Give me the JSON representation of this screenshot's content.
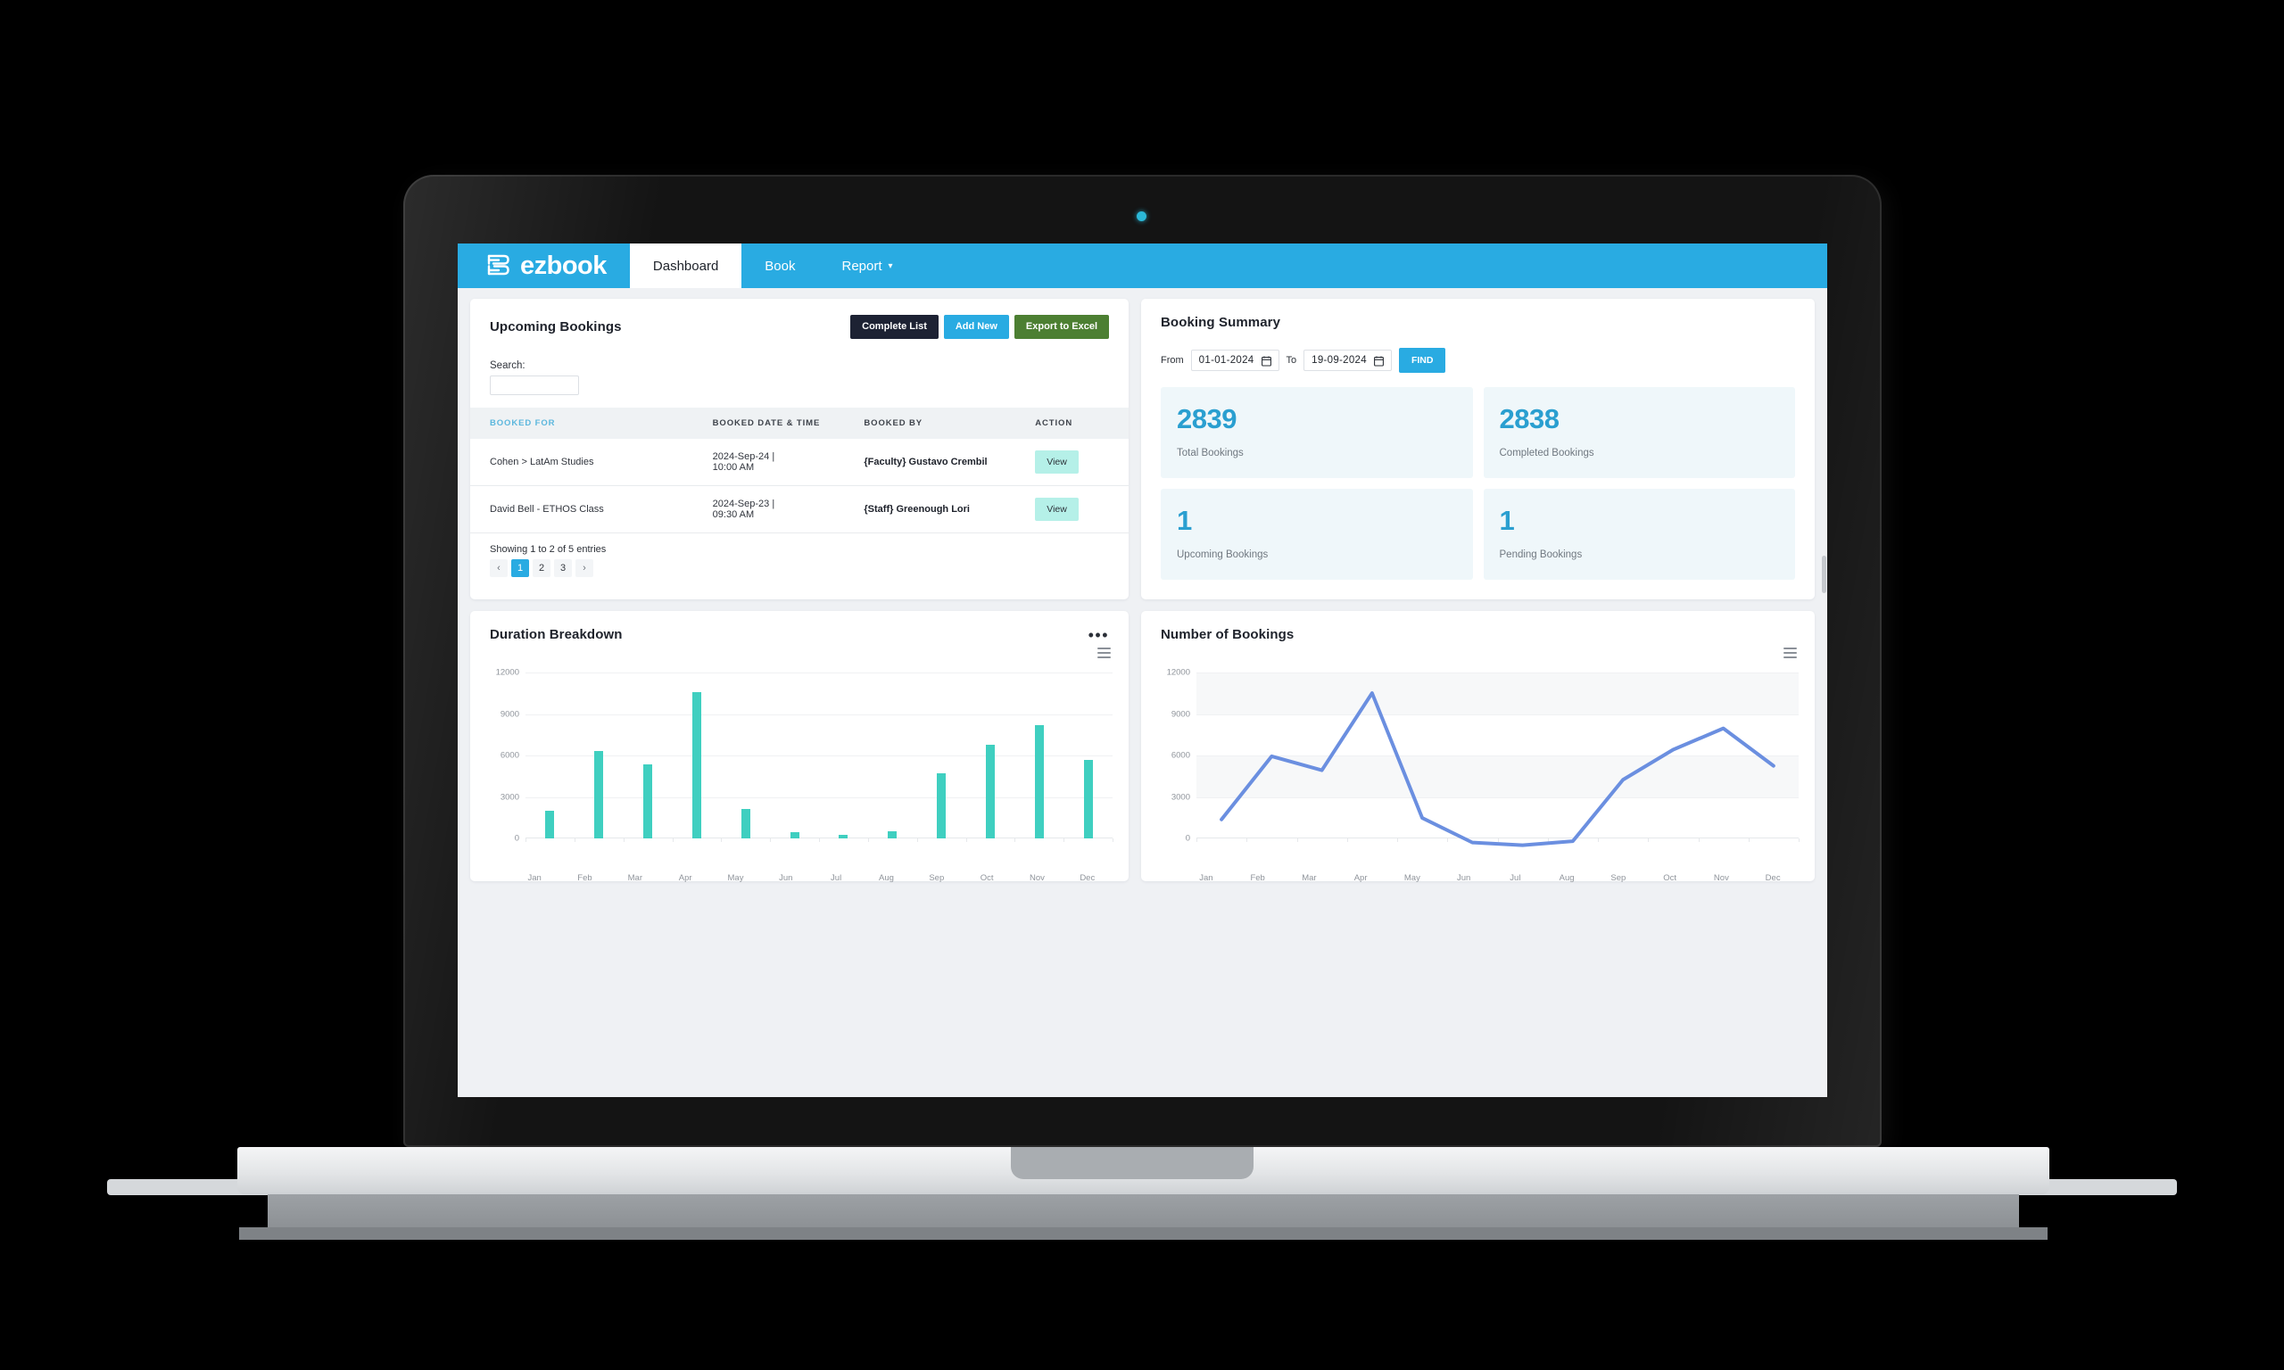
{
  "brand": {
    "name": "ezbook",
    "logo_icon": "ezbook-logo-icon"
  },
  "nav": {
    "items": [
      {
        "label": "Dashboard",
        "active": true
      },
      {
        "label": "Book",
        "active": false
      },
      {
        "label": "Report",
        "active": false,
        "caret": "⌄"
      }
    ]
  },
  "upcoming": {
    "title": "Upcoming Bookings",
    "buttons": {
      "complete_list": "Complete List",
      "add_new": "Add New",
      "export": "Export to Excel"
    },
    "search_label": "Search:",
    "search_value": "",
    "search_placeholder": "",
    "columns": [
      "BOOKED FOR",
      "BOOKED DATE & TIME",
      "BOOKED BY",
      "ACTION"
    ],
    "rows": [
      {
        "booked_for": "Cohen > LatAm Studies",
        "date": "2024-Sep-24 |",
        "time": "10:00 AM",
        "booked_by": "{Faculty} Gustavo Crembil",
        "action": "View"
      },
      {
        "booked_for": "David Bell - ETHOS Class",
        "date": "2024-Sep-23 |",
        "time": "09:30 AM",
        "booked_by": "{Staff} Greenough Lori",
        "action": "View"
      }
    ],
    "showing": "Showing 1 to 2 of 5 entries",
    "pagination": {
      "prev": "‹",
      "pages": [
        "1",
        "2",
        "3"
      ],
      "next": "›",
      "current": "1"
    }
  },
  "summary": {
    "title": "Booking Summary",
    "from_label": "From",
    "from_value": "01-01-2024",
    "to_label": "To",
    "to_value": "19-09-2024",
    "find_label": "FIND",
    "calendar_icon": "calendar-icon",
    "stats": [
      {
        "value": "2839",
        "label": "Total Bookings"
      },
      {
        "value": "2838",
        "label": "Completed Bookings"
      },
      {
        "value": "1",
        "label": "Upcoming Bookings"
      },
      {
        "value": "1",
        "label": "Pending Bookings"
      }
    ]
  },
  "duration_card": {
    "title": "Duration Breakdown",
    "menu_icon": "more-options-icon",
    "export_icon": "chart-menu-icon"
  },
  "bookings_card": {
    "title": "Number of Bookings",
    "export_icon": "chart-menu-icon"
  },
  "colors": {
    "brand_blue": "#29abe2",
    "bar_teal": "#3fcfc0",
    "line_blue": "#6b8fe0",
    "stat_blue": "#2a9fd0",
    "dark_button": "#1d2233",
    "green_button": "#4c7f32",
    "view_chip": "#b5f0e8"
  },
  "chart_data": [
    {
      "type": "bar",
      "title": "Duration Breakdown",
      "categories": [
        "Jan",
        "Feb",
        "Mar",
        "Apr",
        "May",
        "Jun",
        "Jul",
        "Aug",
        "Sep",
        "Oct",
        "Nov",
        "Dec"
      ],
      "values": [
        2000,
        6300,
        5350,
        10600,
        2100,
        430,
        250,
        520,
        4700,
        6750,
        8200,
        5650
      ],
      "xlabel": "",
      "ylabel": "",
      "ylim": [
        0,
        12000
      ],
      "yticks": [
        0,
        3000,
        6000,
        9000,
        12000
      ],
      "grid": true,
      "legend": false
    },
    {
      "type": "line",
      "title": "Number of Bookings",
      "categories": [
        "Jan",
        "Feb",
        "Mar",
        "Apr",
        "May",
        "Jun",
        "Jul",
        "Aug",
        "Sep",
        "Oct",
        "Nov",
        "Dec"
      ],
      "values": [
        2000,
        6300,
        5350,
        10600,
        2100,
        430,
        250,
        520,
        4700,
        6750,
        8200,
        5650
      ],
      "xlabel": "",
      "ylabel": "",
      "ylim": [
        0,
        12000
      ],
      "yticks": [
        0,
        3000,
        6000,
        9000,
        12000
      ],
      "grid": true,
      "legend": false
    }
  ]
}
